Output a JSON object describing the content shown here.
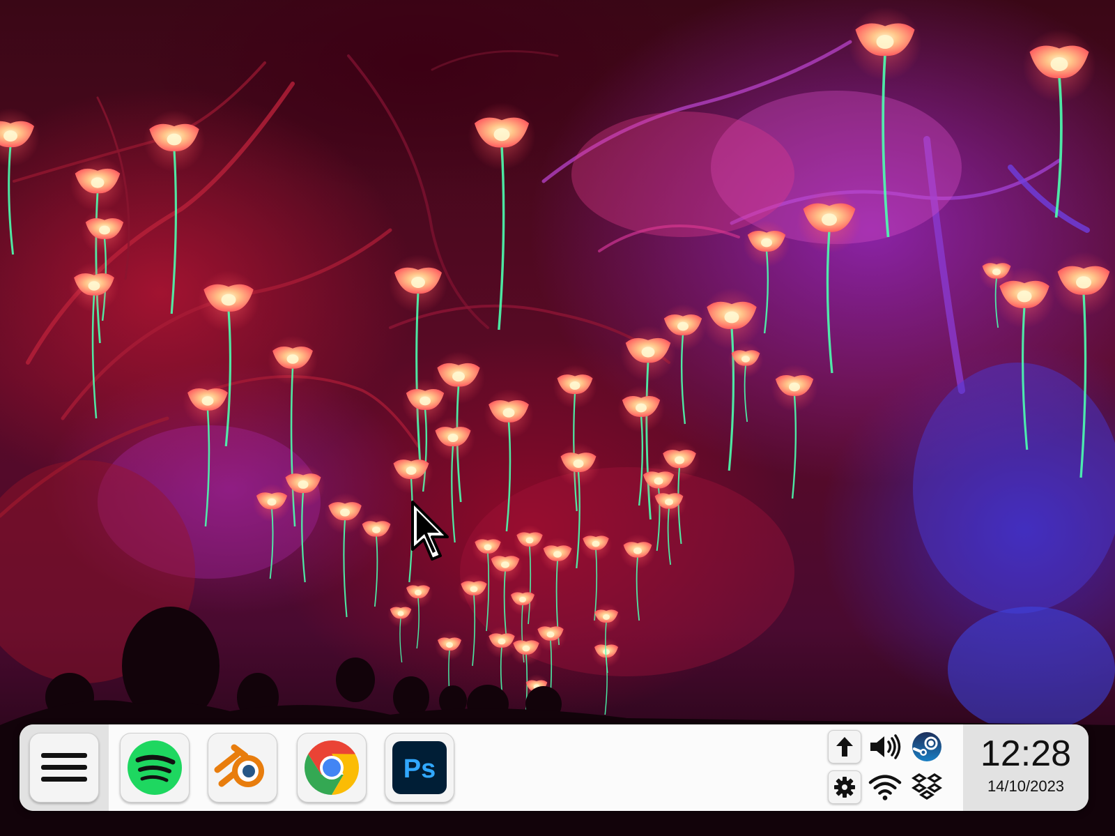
{
  "desktop": {
    "wallpaper": "night garden with glowing red poppy lanterns"
  },
  "taskbar": {
    "menu_icon": "hamburger-menu-icon",
    "apps": [
      {
        "name": "Spotify",
        "icon": "spotify-icon",
        "color": "#1ed760"
      },
      {
        "name": "Blender",
        "icon": "blender-icon",
        "color": "#e87d0d"
      },
      {
        "name": "Google Chrome",
        "icon": "chrome-icon",
        "color": "#4285f4"
      },
      {
        "name": "Photoshop",
        "icon": "photoshop-icon",
        "color": "#31a8ff",
        "label": "Ps"
      }
    ],
    "tray": [
      {
        "icon": "upload-arrow-icon"
      },
      {
        "icon": "volume-icon"
      },
      {
        "icon": "steam-icon"
      },
      {
        "icon": "settings-gear-icon"
      },
      {
        "icon": "wifi-icon"
      },
      {
        "icon": "dropbox-icon"
      }
    ],
    "clock": {
      "time": "12:28",
      "date": "14/10/2023"
    }
  },
  "colors": {
    "taskbar_bg": "#fbfbfb",
    "zone_bg": "#e2e2e2",
    "stem": "#4dffb0",
    "lantern": "#ffb07a"
  }
}
